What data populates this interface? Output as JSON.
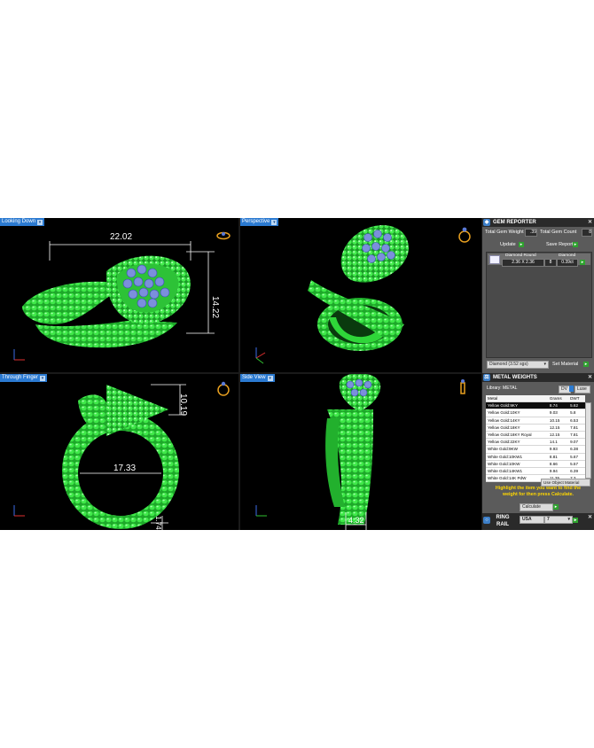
{
  "viewports": {
    "top_left": {
      "label": "Looking Down",
      "dim_width": "22.02",
      "dim_height": "14.22"
    },
    "top_right": {
      "label": "Perspective"
    },
    "bottom_left": {
      "label": "Through Finger",
      "dim_diameter": "17.33",
      "dim_height": "10.19",
      "dim_bottom": "1.74"
    },
    "bottom_right": {
      "label": "Side View",
      "dim_bottom": "4.32"
    }
  },
  "gem_reporter": {
    "title": "GEM REPORTER",
    "total_weight_label": "Total Gem Weight",
    "total_weight_value": ".39",
    "total_count_label": "Total Gem Count",
    "total_count_value": "8",
    "update_label": "Update",
    "save_report_label": "Save Report",
    "gem_shape": "Diamond Round",
    "gem_size": "2.36 X 2.36",
    "gem_type": "Diamond",
    "gem_count": "8",
    "gem_weight": "0.39ct",
    "material_select": "Diamond  (3.52 sgs)",
    "set_material_label": "Set Material"
  },
  "metal_weights": {
    "title": "METAL WEIGHTS",
    "library_label": "Library: METAL",
    "unit_left": "DV",
    "unit_right": "Luse",
    "columns": [
      "Metal",
      "Grams",
      "DWT"
    ],
    "rows": [
      [
        "Yellow Gold:9KY",
        "8.74",
        "5.62"
      ],
      [
        "Yellow Gold:10KY",
        "9.03",
        "5.8"
      ],
      [
        "Yellow Gold:14KY",
        "10.15",
        "6.53"
      ],
      [
        "Yellow Gold:18KY",
        "12.15",
        "7.81"
      ],
      [
        "Yellow Gold:18KY Royal",
        "12.15",
        "7.81"
      ],
      [
        "Yellow Gold:22KY",
        "14.1",
        "9.07"
      ],
      [
        "White Gold:9KW",
        "9.93",
        "6.38"
      ],
      [
        "White Gold:10KW1",
        "8.81",
        "5.67"
      ],
      [
        "White Gold:10KW",
        "8.66",
        "5.57"
      ],
      [
        "White Gold:14KW1",
        "9.94",
        "6.39"
      ],
      [
        "White Gold:14K PdW",
        "11.35",
        "7.3"
      ]
    ],
    "use_object_material": "Use Object Material",
    "hint": "Highlight the item you want to find the weight for then press Calculate.",
    "calculate_label": "Calculate"
  },
  "ring_rail": {
    "title": "RING RAIL",
    "system": "USA",
    "size": "7"
  },
  "colors": {
    "ring": "#32dc3c",
    "gem": "#7b8fdc",
    "accent": "#2b7ad1",
    "hint": "#ffd700"
  }
}
